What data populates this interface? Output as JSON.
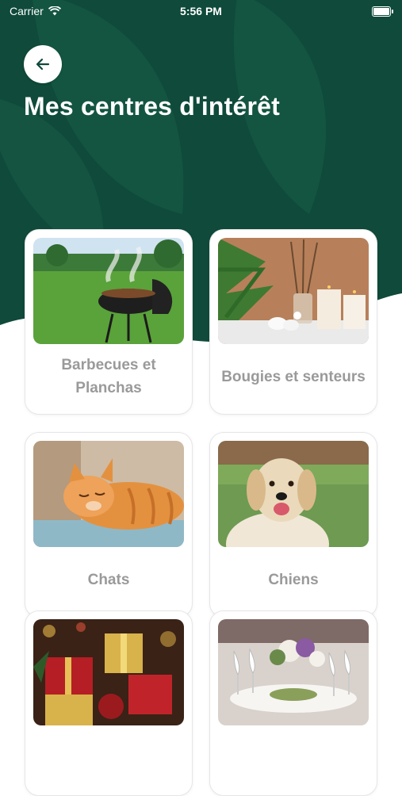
{
  "status_bar": {
    "carrier": "Carrier",
    "time": "5:56 PM"
  },
  "header": {
    "title": "Mes centres d'intérêt",
    "back_icon": "arrow-left-icon"
  },
  "colors": {
    "hero_green": "#0f4a3a",
    "leaf_green": "#1a5e4a",
    "label_gray": "#9a9a9a"
  },
  "interests": [
    {
      "label": "Barbecues et Planchas",
      "image": "barbecue-photo"
    },
    {
      "label": "Bougies et senteurs",
      "image": "candles-photo"
    },
    {
      "label": "Chats",
      "image": "cat-photo"
    },
    {
      "label": "Chiens",
      "image": "dog-photo"
    },
    {
      "label": "",
      "image": "christmas-gifts-photo"
    },
    {
      "label": "",
      "image": "table-setting-photo"
    }
  ]
}
